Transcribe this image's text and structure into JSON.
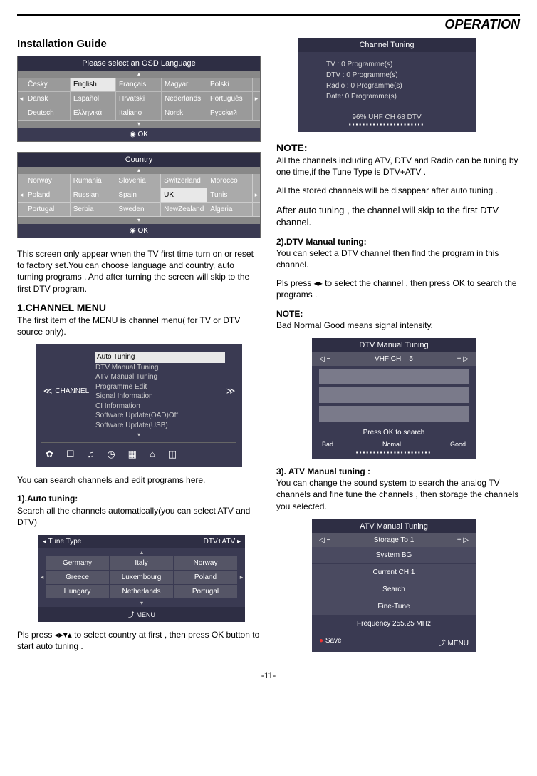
{
  "header": {
    "title": "OPERATION"
  },
  "left": {
    "install_title": "Installation Guide",
    "osd_lang": {
      "title": "Please select an OSD Language",
      "rows": [
        [
          "Česky",
          "English",
          "Français",
          "Magyar",
          "Polski"
        ],
        [
          "Dansk",
          "Español",
          "Hrvatski",
          "Nederlands",
          "Português"
        ],
        [
          "Deutsch",
          "Ελληνικά",
          "Italiano",
          "Norsk",
          "Рycckий"
        ]
      ],
      "selected": "English",
      "ok": "OK"
    },
    "country": {
      "title": "Country",
      "rows": [
        [
          "Norway",
          "Rumania",
          "Slovenia",
          "Switzerland",
          "Morocco"
        ],
        [
          "Poland",
          "Russian",
          "Spain",
          "UK",
          "Tunis"
        ],
        [
          "Portugal",
          "Serbia",
          "Sweden",
          "NewZealand",
          "Algeria"
        ]
      ],
      "selected": "UK",
      "ok": "OK"
    },
    "intro_para": "This screen only appear when the TV first time turn on or reset to factory set.You can choose language and country, auto turning programs . And after turning the screen will  skip to the first DTV program.",
    "ch_menu_title": "1.CHANNEL MENU",
    "ch_menu_para": "The first item of the MENU is channel menu( for TV or DTV source only).",
    "channel_menu": {
      "label": "CHANNEL",
      "items": [
        "Auto Tuning",
        "DTV Manual Tuning",
        "ATV Manual Tuning",
        "Programme Edit",
        "Signal Information",
        "CI Information",
        "Software Update(OAD)Off",
        "Software Update(USB)"
      ],
      "selected": "Auto Tuning"
    },
    "search_para": "You can search  channels and edit programs  here.",
    "auto_title": "1).Auto tuning:",
    "auto_para": "Search all the channels automatically(you can select ATV and DTV)",
    "tune_type": {
      "label": "Tune Type",
      "value": "DTV+ATV",
      "rows": [
        [
          "Germany",
          "Italy",
          "Norway"
        ],
        [
          "Greece",
          "Luxembourg",
          "Poland"
        ],
        [
          "Hungary",
          "Netherlands",
          "Portugal"
        ]
      ],
      "footer": "MENU"
    },
    "pls_press_country": "Pls press ◂▸▾▴ to select  country at first , then press OK button to start auto tuning ."
  },
  "right": {
    "ch_tuning": {
      "title": "Channel Tuning",
      "l1": "TV    : 0 Programme(s)",
      "l2": "DTV : 0 Programme(s)",
      "l3": "Radio : 0 Programme(s)",
      "l4": "Date:  0 Programme(s)",
      "status": "96%   UHF   CH   68 DTV"
    },
    "note_label": "NOTE:",
    "note1": "All the channels including ATV,  DTV and Radio can be tuning by one time,if the Tune Type is DTV+ATV .",
    "note2": "All the stored channels will be disappear after auto tuning .",
    "note3": "After auto tuning , the channel will skip to the first DTV channel.",
    "dtv_manual_title": "2).DTV Manual tuning:",
    "dtv_manual_para": "You can select a DTV channel then  find the program in this channel.",
    "pls_press_ch": "Pls press ◂▸ to select the channel , then press OK to search the programs .",
    "note4": "Bad Normal Good means signal intensity.",
    "dtvm": {
      "title": "DTV Manual Tuning",
      "band": "VHF CH",
      "ch": "5",
      "press": "Press OK to search",
      "bad": "Bad",
      "normal": "Nomal",
      "good": "Good"
    },
    "atv_title": "3). ATV  Manual tuning :",
    "atv_para": "You can change the sound system to search the analog TV channels and fine tune the channels , then storage the channels you selected.",
    "atvm": {
      "title": "ATV Manual Tuning",
      "storage": "Storage To 1",
      "system": "System BG",
      "current": "Current CH 1",
      "search": "Search",
      "fine": "Fine-Tune",
      "freq": "Frequency  255.25  MHz",
      "save": "Save",
      "menu": "MENU"
    }
  },
  "page_num": "-11-"
}
